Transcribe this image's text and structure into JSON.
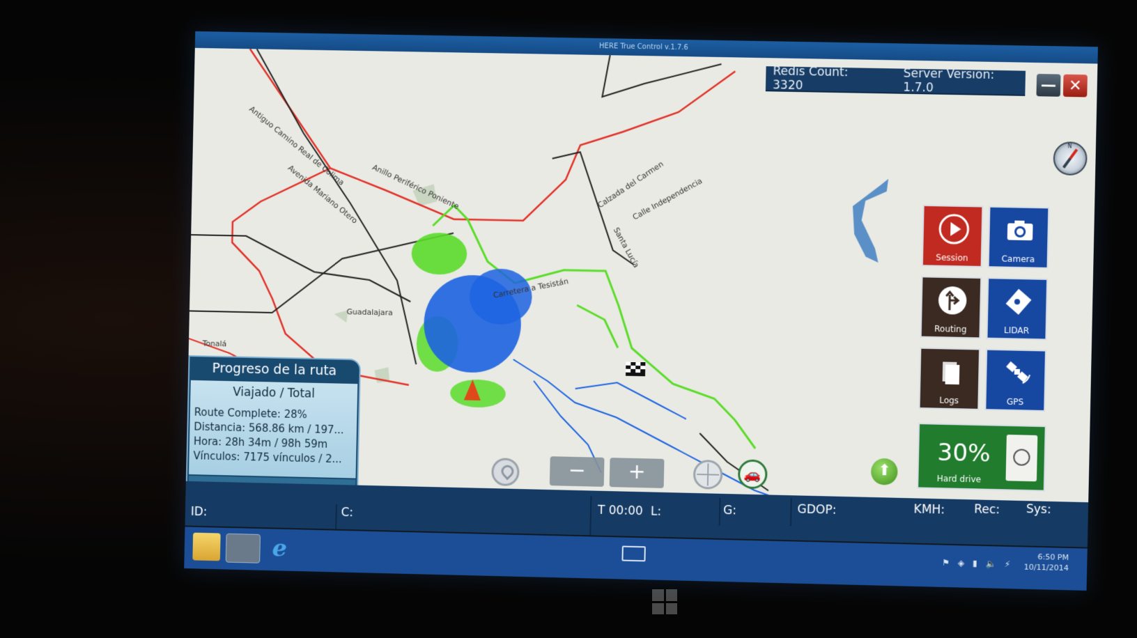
{
  "window": {
    "title": "HERE True Control v.1.7.6"
  },
  "server": {
    "redis_label": "Redis Count:",
    "redis_value": "3320",
    "server_label": "Server Version:",
    "server_value": "1.7.0"
  },
  "window_controls": {
    "minimize": "—",
    "close": "✕"
  },
  "map": {
    "labels": [
      "Antiguo Camino Real de Colima",
      "Avenida Mariano Otero",
      "Anillo Periférico Poniente",
      "Calzada del Carmen",
      "Calle Independencia",
      "Santa Lucía",
      "Carretera a Tesistán",
      "Guadalajara",
      "Tonalá"
    ],
    "colors": {
      "background": "#e9eae3",
      "red_road": "#e0322a",
      "black_road": "#222222",
      "green_track": "#5bdc2a",
      "blue_track": "#1d63e0",
      "water": "#5b8fc7"
    }
  },
  "compass": {
    "n": "N"
  },
  "tiles": [
    {
      "id": "session",
      "label": "Session",
      "icon": "play-icon"
    },
    {
      "id": "camera",
      "label": "Camera",
      "icon": "camera-icon"
    },
    {
      "id": "routing",
      "label": "Routing",
      "icon": "routing-icon"
    },
    {
      "id": "lidar",
      "label": "LIDAR",
      "icon": "lidar-icon"
    },
    {
      "id": "logs",
      "label": "Logs",
      "icon": "logs-icon"
    },
    {
      "id": "gps",
      "label": "GPS",
      "icon": "satellite-icon"
    }
  ],
  "hard_drive": {
    "percent": "30%",
    "label": "Hard drive",
    "value": 0.3
  },
  "route_panel": {
    "title": "Progreso de la ruta",
    "subtitle": "Viajado / Total",
    "rows": [
      "Route Complete: 28%",
      "Distancia: 568.86 km / 197...",
      "Hora: 28h 34m / 98h 59m",
      "Vínculos: 7175 vínculos / 2..."
    ]
  },
  "map_controls": {
    "zoom_out": "−",
    "zoom_in": "+",
    "car": "🚗",
    "up": "⬆"
  },
  "status_bar": {
    "id": "ID:",
    "c": "C:",
    "t": "T 00:00",
    "l": "L:",
    "g": "G:",
    "gdop": "GDOP:",
    "kmh": "KMH:",
    "rec": "Rec:",
    "sys": "Sys:"
  },
  "taskbar": {
    "ie": "e",
    "tray": "⚑ ◈ ▮ 🔈 ⚡",
    "time": "6:50 PM",
    "date": "10/11/2014"
  }
}
